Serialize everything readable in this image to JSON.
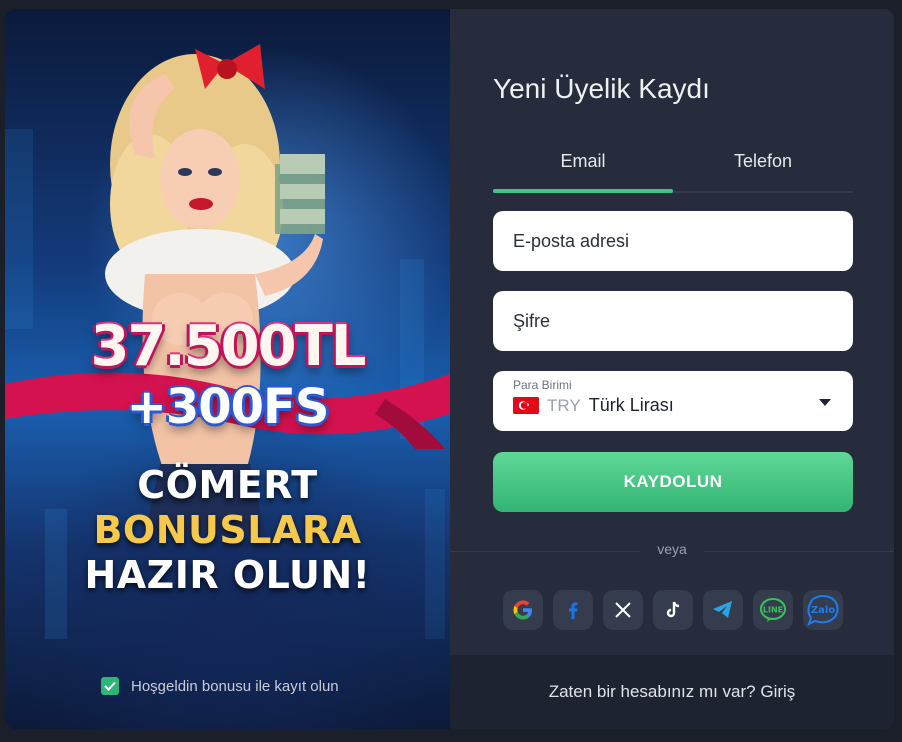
{
  "promo": {
    "amount": "37.500TL",
    "freespins": "+300FS",
    "slogan_line1": "CÖMERT",
    "slogan_line2": "BONUSLARA",
    "slogan_line3": "HAZIR OLUN!",
    "bonus_checkbox_label": "Hoşgeldin bonusu ile kayıt olun",
    "bonus_checked": true
  },
  "form": {
    "title": "Yeni Üyelik Kaydı",
    "tabs": [
      {
        "label": "Email",
        "active": true
      },
      {
        "label": "Telefon",
        "active": false
      }
    ],
    "email_placeholder": "E-posta adresi",
    "password_placeholder": "Şifre",
    "currency": {
      "label": "Para Birimi",
      "code": "TRY",
      "name": "Türk Lirası"
    },
    "submit_label": "KAYDOLUN",
    "or_label": "veya",
    "socials": [
      "google-icon",
      "facebook-icon",
      "x-icon",
      "tiktok-icon",
      "telegram-icon",
      "line-icon",
      "zalo-icon"
    ],
    "footer_text": "Zaten bir hesabınız mı var?",
    "footer_link": "Giriş"
  },
  "colors": {
    "accent": "#3fc488",
    "panel": "#262c3b",
    "footer": "#1e2331"
  }
}
